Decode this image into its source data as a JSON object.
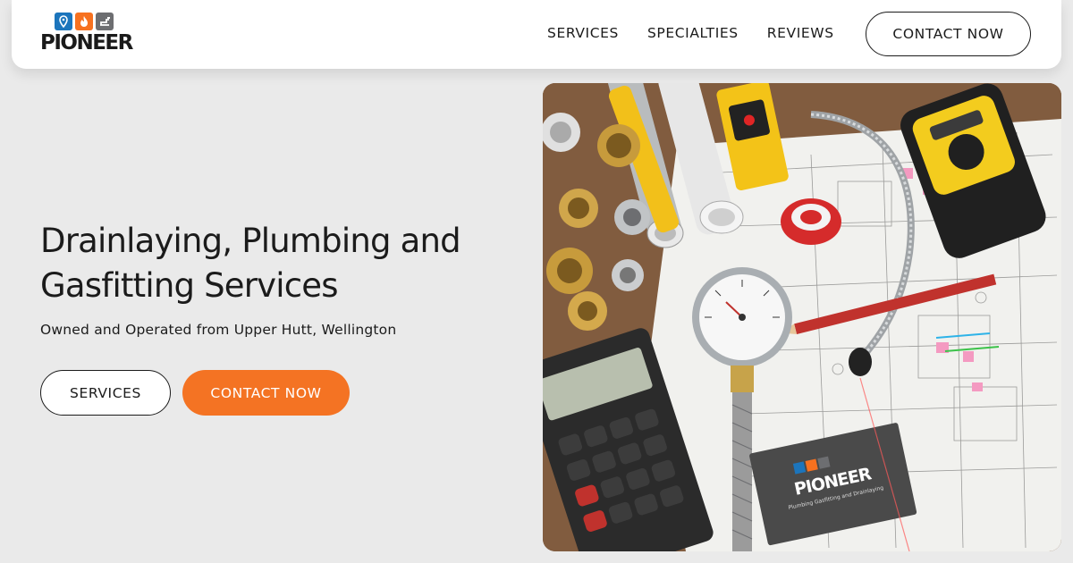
{
  "brand": {
    "name": "PIONEER",
    "logo_icons": [
      "map-pin-icon",
      "flame-icon",
      "faucet-icon"
    ]
  },
  "nav": {
    "links": [
      "SERVICES",
      "SPECIALTIES",
      "REVIEWS"
    ],
    "cta": "CONTACT NOW"
  },
  "hero": {
    "title": "Drainlaying, Plumbing and Gasfitting Services",
    "subtitle": "Owned and Operated from Upper Hutt, Wellington",
    "buttons": {
      "services": "SERVICES",
      "contact": "CONTACT NOW"
    },
    "image_card": {
      "brand": "PIONEER",
      "tagline": "Plumbing Gasfitting and Drainlaying"
    }
  },
  "colors": {
    "accent_orange": "#f47323",
    "logo_blue": "#1c75bc",
    "logo_grey": "#6d6e71",
    "page_background": "#eaeaea"
  }
}
